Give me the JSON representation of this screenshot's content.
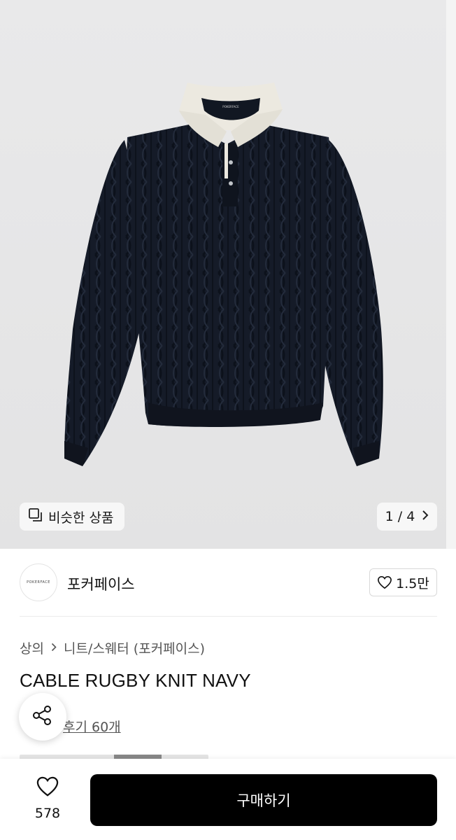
{
  "hero": {
    "collar_brand": "POKERFACE",
    "similar_label": "비슷한 상품",
    "pager": "1 / 4"
  },
  "seller": {
    "logo_text": "POKERFACE",
    "name": "포커페이스",
    "likes": "1.5만"
  },
  "breadcrumb": {
    "level1": "상의",
    "level2": "니트/스웨터 (포커페이스)"
  },
  "product": {
    "title": "CABLE RUGBY KNIT NAVY",
    "reviews": "후기 60개",
    "gallery_progress": 0.5
  },
  "bottom": {
    "wish_count": "578",
    "buy_label": "구매하기"
  },
  "icons": {
    "similar": "copy-squares-icon",
    "pager": "chevron-right-icon",
    "like": "heart-outline-icon",
    "share": "share-icon",
    "wish": "heart-outline-icon"
  },
  "colors": {
    "sweater": "#141a26",
    "collar": "#ece9e0",
    "buy_button": "#000000",
    "background": "#e6e6e7"
  }
}
